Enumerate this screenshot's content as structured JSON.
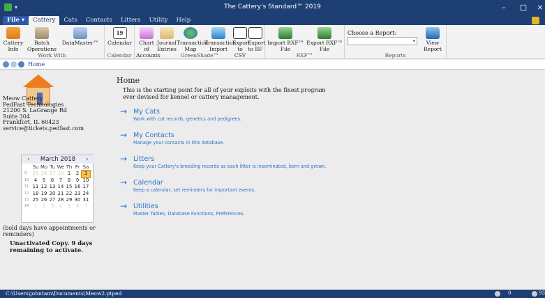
{
  "window": {
    "title": "The Cattery's Standard™ 2019",
    "minimize": "–",
    "maximize": "▢",
    "close": "×"
  },
  "menubar": {
    "file": "File ▾",
    "items": [
      "Cattery",
      "Cats",
      "Contacts",
      "Litters",
      "Utility",
      "Help"
    ]
  },
  "ribbon": {
    "work_with": {
      "label": "Work With",
      "buttons": [
        "Cattery Info",
        "Batch Operations",
        "DataMaster™"
      ]
    },
    "calendar": {
      "label": "Calendar",
      "button": "Calendar",
      "icon_text": "19"
    },
    "greenshade": {
      "label": "GreenShade™",
      "buttons": [
        "Chart of Accounts",
        "Journal Entries",
        "Transaction Map",
        "Transaction Import",
        "Export to CSV",
        "Export to IIF"
      ]
    },
    "rxf": {
      "label": "RXF™",
      "buttons": [
        "Import RXF™ File",
        "Export RXF™ File"
      ]
    },
    "reports": {
      "label": "Reports",
      "choose": "Choose a Report:",
      "view": "View Report"
    }
  },
  "navbar": {
    "crumb": "Home"
  },
  "left": {
    "address": [
      "Meow Cattery",
      "PedFast Technologies",
      "21200 S. LaGrange Rd",
      "Suite 304",
      "Frankfort, IL 60423",
      "service@tickets.pedfast.com"
    ],
    "calendar": {
      "prev": "‹",
      "next": "›",
      "month": "March 2018",
      "dow": [
        "Su",
        "Mo",
        "Tu",
        "We",
        "Th",
        "Fr",
        "Sa"
      ],
      "weeks": [
        {
          "wk": "9",
          "days": [
            "25",
            "26",
            "27",
            "28",
            "1",
            "2",
            "3"
          ]
        },
        {
          "wk": "10",
          "days": [
            "4",
            "5",
            "6",
            "7",
            "8",
            "9",
            "10"
          ]
        },
        {
          "wk": "11",
          "days": [
            "11",
            "12",
            "13",
            "14",
            "15",
            "16",
            "17"
          ]
        },
        {
          "wk": "12",
          "days": [
            "18",
            "19",
            "20",
            "21",
            "22",
            "23",
            "24"
          ]
        },
        {
          "wk": "13",
          "days": [
            "25",
            "26",
            "27",
            "28",
            "29",
            "30",
            "31"
          ]
        },
        {
          "wk": "14",
          "days": [
            "1",
            "2",
            "3",
            "4",
            "5",
            "6",
            "7"
          ]
        }
      ],
      "today": "3"
    },
    "bold_note": "(bold days have appointments or reminders)",
    "unactivated": "Unactivated Copy. 9 days remaining to activate."
  },
  "main": {
    "heading": "Home",
    "intro": "This is the starting point for all of your exploits with the finest program ever devised for kennel or cattery management.",
    "links": [
      {
        "title": "My Cats",
        "desc": "Work with cat records, genetics and pedigrees."
      },
      {
        "title": "My Contacts",
        "desc": "Manage your contacts in this database."
      },
      {
        "title": "Litters",
        "desc": "Keep your Cattery's breeding records as each litter is inseminated, born and grown."
      },
      {
        "title": "Calendar",
        "desc": "Keep a calendar, set reminders for important events."
      },
      {
        "title": "Utilities",
        "desc": "Master Tables, Database Functions, Preferences."
      }
    ]
  },
  "status": {
    "path": "C:\\Users\\johntam\\Documents\\Meow2.ptped",
    "item2": "0",
    "item4": "93"
  }
}
